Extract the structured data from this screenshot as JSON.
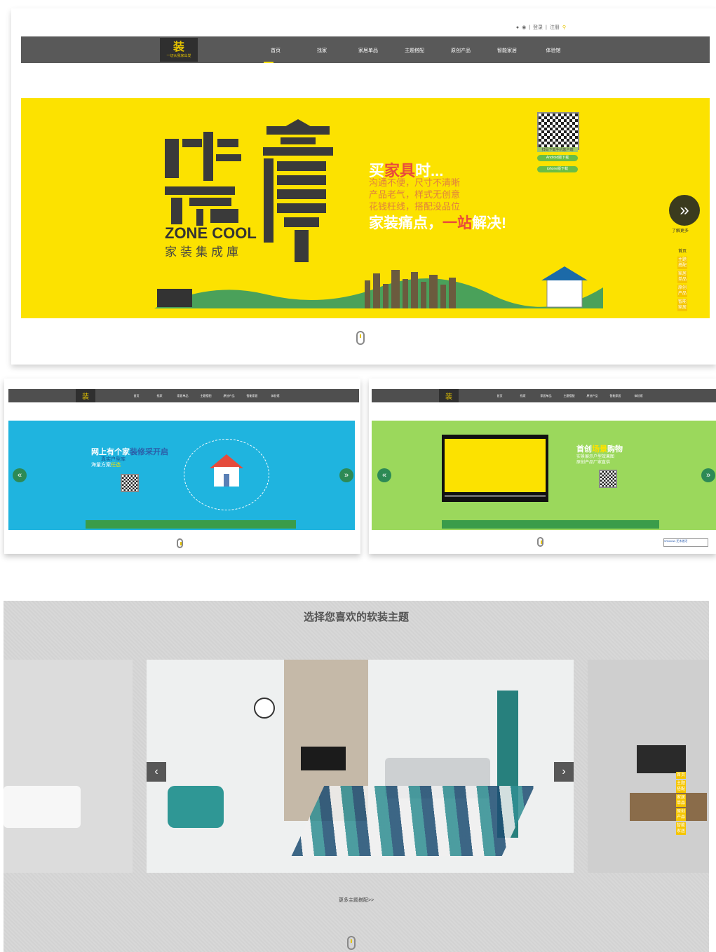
{
  "top_links": {
    "login": "登录",
    "sep1": "|",
    "register": "注册",
    "sep2": "|"
  },
  "logo": {
    "mark": "装",
    "mark2": "庫",
    "slogan": "一切从我家出发"
  },
  "nav": [
    "首页",
    "找家",
    "家居单品",
    "主题搭配",
    "原创产品",
    "智能家居",
    "体验馆"
  ],
  "hero": {
    "logo_text_en": "ZONE COOL",
    "logo_text_cn": "家装集成庫",
    "slogan_lead": "买",
    "slogan_red": "家具",
    "slogan_tail": "时...",
    "pain_points": [
      "沟通不便，尺寸不清晰",
      "产品老气，样式无创意",
      "花钱枉线，搭配没品位"
    ],
    "slogan2_a": "家装痛点，",
    "slogan2_b": "一站",
    "slogan2_c": "解决!",
    "qr_caption": "扫码下载手机客户端",
    "android_btn": "Android版下载",
    "iphone_btn": "iphone版下载",
    "learn_more": "了解更多"
  },
  "side_menu_main": [
    "首页",
    "主题搭配",
    "家居单品",
    "原创产品",
    "智能家居"
  ],
  "side_menu_bottom": [
    "首页",
    "主题搭配",
    "家居单品",
    "原创产品",
    "智能家居"
  ],
  "blue_banner": {
    "line1_a": "网上有个家",
    "line1_b": "装修采开启",
    "line2": "真实户型库",
    "line3_a": "海量方案",
    "line3_b": "任选"
  },
  "green_banner": {
    "line1_a": "首创",
    "line1_b": "场景",
    "line1_c": "购物",
    "line2": "实景展示户型效果图",
    "line3": "原创产品厂家直供"
  },
  "windows_notice": "Windows 还未激活",
  "theme": {
    "title": "选择您喜欢的软装主题",
    "more": "更多主题搭配>>"
  },
  "colors": {
    "accent_yellow": "#fce200",
    "nav_dark": "#595959",
    "blue": "#1fb4df",
    "green": "#9bd85c"
  },
  "icons": [
    "wechat-icon",
    "weibo-icon",
    "search-icon",
    "mouse-scroll-icon",
    "chevron-right-icon",
    "chevron-left-icon"
  ]
}
